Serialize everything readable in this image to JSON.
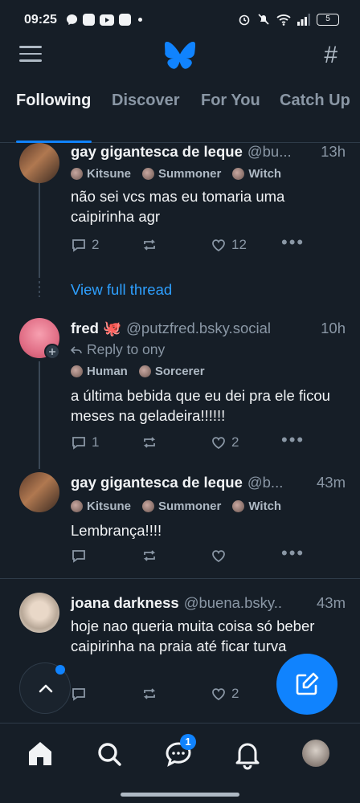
{
  "status_bar": {
    "time": "09:25",
    "battery": "5"
  },
  "tabs": [
    "Following",
    "Discover",
    "For You",
    "Catch Up"
  ],
  "colors": {
    "accent": "#1083fe",
    "background": "#161e27",
    "link": "#2ea0ff"
  },
  "posts": [
    {
      "name": "gay gigantesca de leque",
      "handle": "@bu...",
      "time": "13h",
      "badges": [
        "Kitsune",
        "Summoner",
        "Witch"
      ],
      "text": "não sei vcs mas eu tomaria uma caipirinha agr",
      "replies": "2",
      "reposts": "",
      "likes": "12"
    },
    {
      "name": "fred 🐙",
      "handle": "@putzfred.bsky.social",
      "time": "10h",
      "reply_to": "Reply to ony",
      "badges": [
        "Human",
        "Sorcerer"
      ],
      "text": "a última bebida que eu dei pra ele ficou meses na geladeira!!!!!!",
      "replies": "1",
      "reposts": "",
      "likes": "2"
    },
    {
      "name": "gay gigantesca de leque",
      "handle": "@b...",
      "time": "43m",
      "badges": [
        "Kitsune",
        "Summoner",
        "Witch"
      ],
      "text": "Lembrança!!!!",
      "replies": "",
      "reposts": "",
      "likes": ""
    },
    {
      "name": "joana darkness",
      "handle": "@buena.bsky..",
      "time": "43m",
      "badges": [],
      "text": "hoje nao queria muita coisa só beber caipirinha na praia até ficar turva",
      "replies": "",
      "reposts": "",
      "likes": "2"
    }
  ],
  "view_full_thread": "View full thread",
  "nav": {
    "chat_badge": "1",
    "icons": [
      "home-icon",
      "search-icon",
      "chat-icon",
      "bell-icon",
      "profile-avatar"
    ]
  }
}
